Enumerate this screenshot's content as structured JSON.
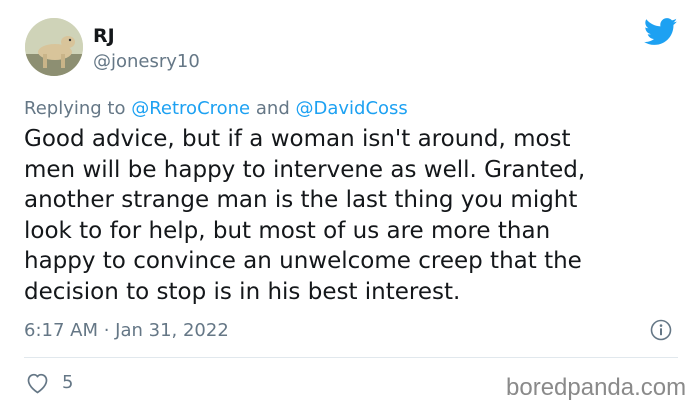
{
  "author": {
    "name": "RJ",
    "handle": "@jonesry10"
  },
  "reply": {
    "prefix": "Replying to",
    "to1": "@RetroCrone",
    "joiner": "and",
    "to2": "@DavidCoss"
  },
  "tweet": {
    "lines": [
      "Good advice, but if a woman isn't around, most",
      "men will be happy to intervene as well. Granted,",
      "another strange man is the last thing you might",
      "look to for help, but most of us are more than",
      "happy to convince an unwelcome creep that the",
      "decision to stop is in his best interest."
    ]
  },
  "meta": {
    "timestamp": "6:17 AM · Jan 31, 2022",
    "likes_count": "5"
  },
  "watermark": "boredpanda.com",
  "colors": {
    "accent": "#1da1f2",
    "muted": "#657786",
    "text": "#14171a",
    "divider": "#e1e8ed"
  },
  "icons": {
    "brand": "twitter-bird-icon",
    "info": "info-icon",
    "like": "heart-icon"
  }
}
